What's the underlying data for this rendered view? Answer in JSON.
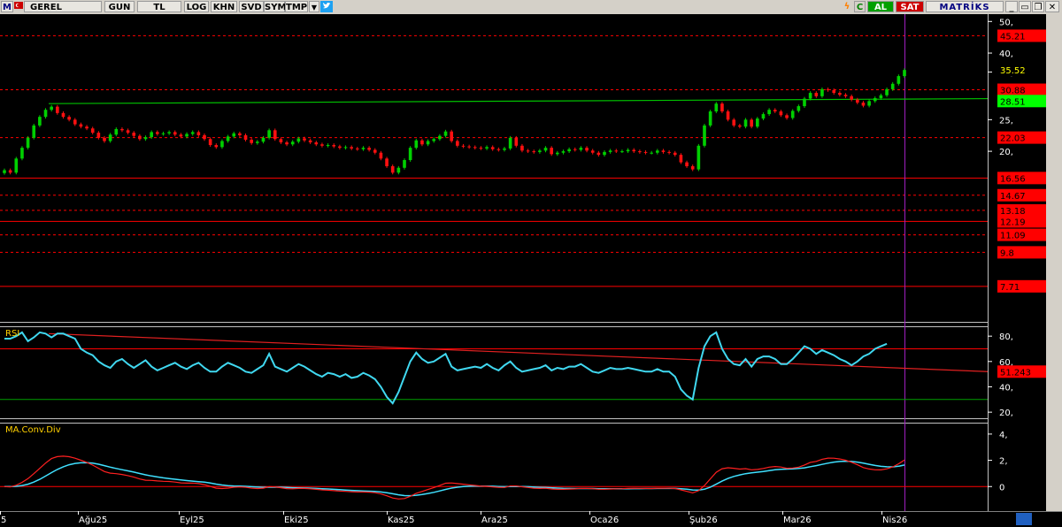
{
  "toolbar": {
    "symbol_prefix": "M",
    "symbol": "GEREL",
    "period": "GUN",
    "currency": "TL",
    "buttons": [
      "LOG",
      "KHN",
      "SVD",
      "SYM",
      "TMP"
    ],
    "buy_label": "AL",
    "sell_label": "SAT",
    "brand": "MATRİKS"
  },
  "chart_data": [
    {
      "type": "candlestick",
      "title": "GEREL",
      "yticks": [
        "50,",
        "40,",
        "35,",
        "25,",
        "20,"
      ],
      "price_labels": [
        {
          "value": "45.21",
          "color": "#ff0000",
          "text_color": "#000000"
        },
        {
          "value": "35.52",
          "color": "#000000",
          "text_color": "#ffff00"
        },
        {
          "value": "30.88",
          "color": "#ff0000",
          "text_color": "#000000"
        },
        {
          "value": "28.51",
          "color": "#00ff00",
          "text_color": "#000000"
        },
        {
          "value": "22.03",
          "color": "#ff0000",
          "text_color": "#000000"
        },
        {
          "value": "16.56",
          "color": "#ff0000",
          "text_color": "#000000"
        },
        {
          "value": "14.67",
          "color": "#ff0000",
          "text_color": "#000000"
        },
        {
          "value": "13.18",
          "color": "#ff0000",
          "text_color": "#000000"
        },
        {
          "value": "12.19",
          "color": "#ff0000",
          "text_color": "#000000"
        },
        {
          "value": "11.09",
          "color": "#ff0000",
          "text_color": "#000000"
        },
        {
          "value": "9.8",
          "color": "#ff0000",
          "text_color": "#000000"
        },
        {
          "value": "7.71",
          "color": "#ff0000",
          "text_color": "#000000"
        }
      ],
      "ylim": [
        6,
        52
      ],
      "x_labels": [
        "5",
        "Ağu25",
        "Eyl25",
        "Eki25",
        "Kas25",
        "Ara25",
        "Oca26",
        "Şub26",
        "Mar26",
        "Nis26"
      ],
      "closes": [
        17.5,
        17.2,
        19.0,
        20.5,
        22.0,
        24.0,
        25.5,
        26.8,
        27.4,
        26.2,
        25.5,
        25.0,
        24.2,
        23.8,
        23.5,
        22.8,
        22.0,
        21.5,
        22.5,
        23.4,
        23.2,
        22.8,
        22.3,
        21.8,
        22.1,
        22.9,
        22.6,
        22.7,
        22.9,
        22.5,
        22.2,
        22.6,
        22.9,
        22.4,
        21.8,
        20.9,
        20.6,
        21.5,
        22.2,
        22.7,
        22.4,
        21.7,
        21.2,
        21.4,
        22.0,
        23.2,
        21.8,
        21.3,
        21.0,
        21.4,
        21.9,
        21.6,
        21.3,
        21.0,
        20.8,
        20.9,
        20.7,
        20.5,
        20.6,
        20.4,
        20.3,
        20.5,
        20.2,
        19.8,
        19.0,
        18.0,
        17.2,
        17.8,
        18.8,
        20.5,
        21.6,
        21.0,
        21.5,
        21.8,
        22.3,
        23.0,
        21.5,
        20.8,
        20.7,
        20.6,
        20.5,
        20.4,
        20.6,
        20.3,
        20.2,
        20.4,
        22.0,
        20.8,
        20.1,
        20.0,
        19.9,
        20.1,
        20.5,
        19.6,
        19.8,
        20.0,
        20.3,
        20.2,
        20.5,
        20.1,
        19.8,
        19.5,
        19.9,
        20.1,
        20.0,
        20.0,
        20.2,
        20.0,
        19.9,
        19.8,
        19.8,
        20.1,
        19.9,
        19.8,
        19.5,
        18.5,
        18.0,
        17.6,
        20.8,
        24.0,
        26.5,
        28.0,
        26.5,
        25.0,
        24.0,
        23.8,
        25.0,
        23.8,
        25.2,
        26.0,
        26.8,
        26.5,
        25.8,
        25.3,
        26.6,
        27.5,
        29.0,
        30.2,
        29.5,
        31.0,
        30.8,
        30.2,
        29.8,
        29.5,
        28.8,
        28.2,
        27.6,
        28.5,
        29.1,
        29.7,
        31.0,
        32.2,
        34.0,
        35.5
      ],
      "support_line": {
        "from": 28.0,
        "to": 29.0
      },
      "horizontal_levels": [
        45.21,
        30.88,
        22.03,
        16.56,
        14.67,
        13.18,
        12.19,
        11.09,
        9.8,
        7.71
      ]
    },
    {
      "type": "line",
      "title": "RSI",
      "yticks": [
        "80,",
        "60,",
        "40,",
        "20,"
      ],
      "ylim": [
        18,
        85
      ],
      "value_label": "51.243",
      "values": [
        78,
        78,
        80,
        83,
        76,
        79,
        83,
        82,
        79,
        82,
        82,
        80,
        78,
        70,
        67,
        65,
        60,
        57,
        55,
        60,
        62,
        58,
        55,
        58,
        61,
        56,
        53,
        55,
        57,
        59,
        56,
        54,
        57,
        59,
        55,
        52,
        52,
        56,
        59,
        57,
        55,
        52,
        51,
        54,
        57,
        66,
        56,
        54,
        52,
        55,
        58,
        56,
        53,
        50,
        48,
        51,
        50,
        48,
        50,
        47,
        48,
        51,
        49,
        46,
        40,
        32,
        27,
        36,
        48,
        60,
        67,
        62,
        59,
        60,
        63,
        66,
        56,
        53,
        54,
        55,
        56,
        55,
        58,
        55,
        53,
        57,
        60,
        55,
        52,
        53,
        54,
        55,
        57,
        53,
        55,
        54,
        56,
        56,
        58,
        55,
        52,
        51,
        53,
        55,
        54,
        54,
        55,
        54,
        53,
        52,
        52,
        54,
        52,
        52,
        48,
        38,
        33,
        30,
        55,
        72,
        80,
        83,
        70,
        62,
        58,
        57,
        62,
        56,
        62,
        64,
        64,
        62,
        58,
        58,
        62,
        67,
        72,
        70,
        66,
        69,
        67,
        65,
        62,
        60,
        57,
        60,
        64,
        66,
        70,
        72,
        74
      ],
      "ref_lines": [
        70,
        30
      ]
    },
    {
      "type": "line",
      "title": "MA.Conv.Div",
      "yticks": [
        "4,",
        "2,",
        "0"
      ],
      "ylim": [
        -1.6,
        4.6
      ],
      "series": [
        {
          "name": "",
          "color": "#ff2020"
        },
        {
          "name": "",
          "color": "#40e0ff"
        }
      ]
    }
  ]
}
